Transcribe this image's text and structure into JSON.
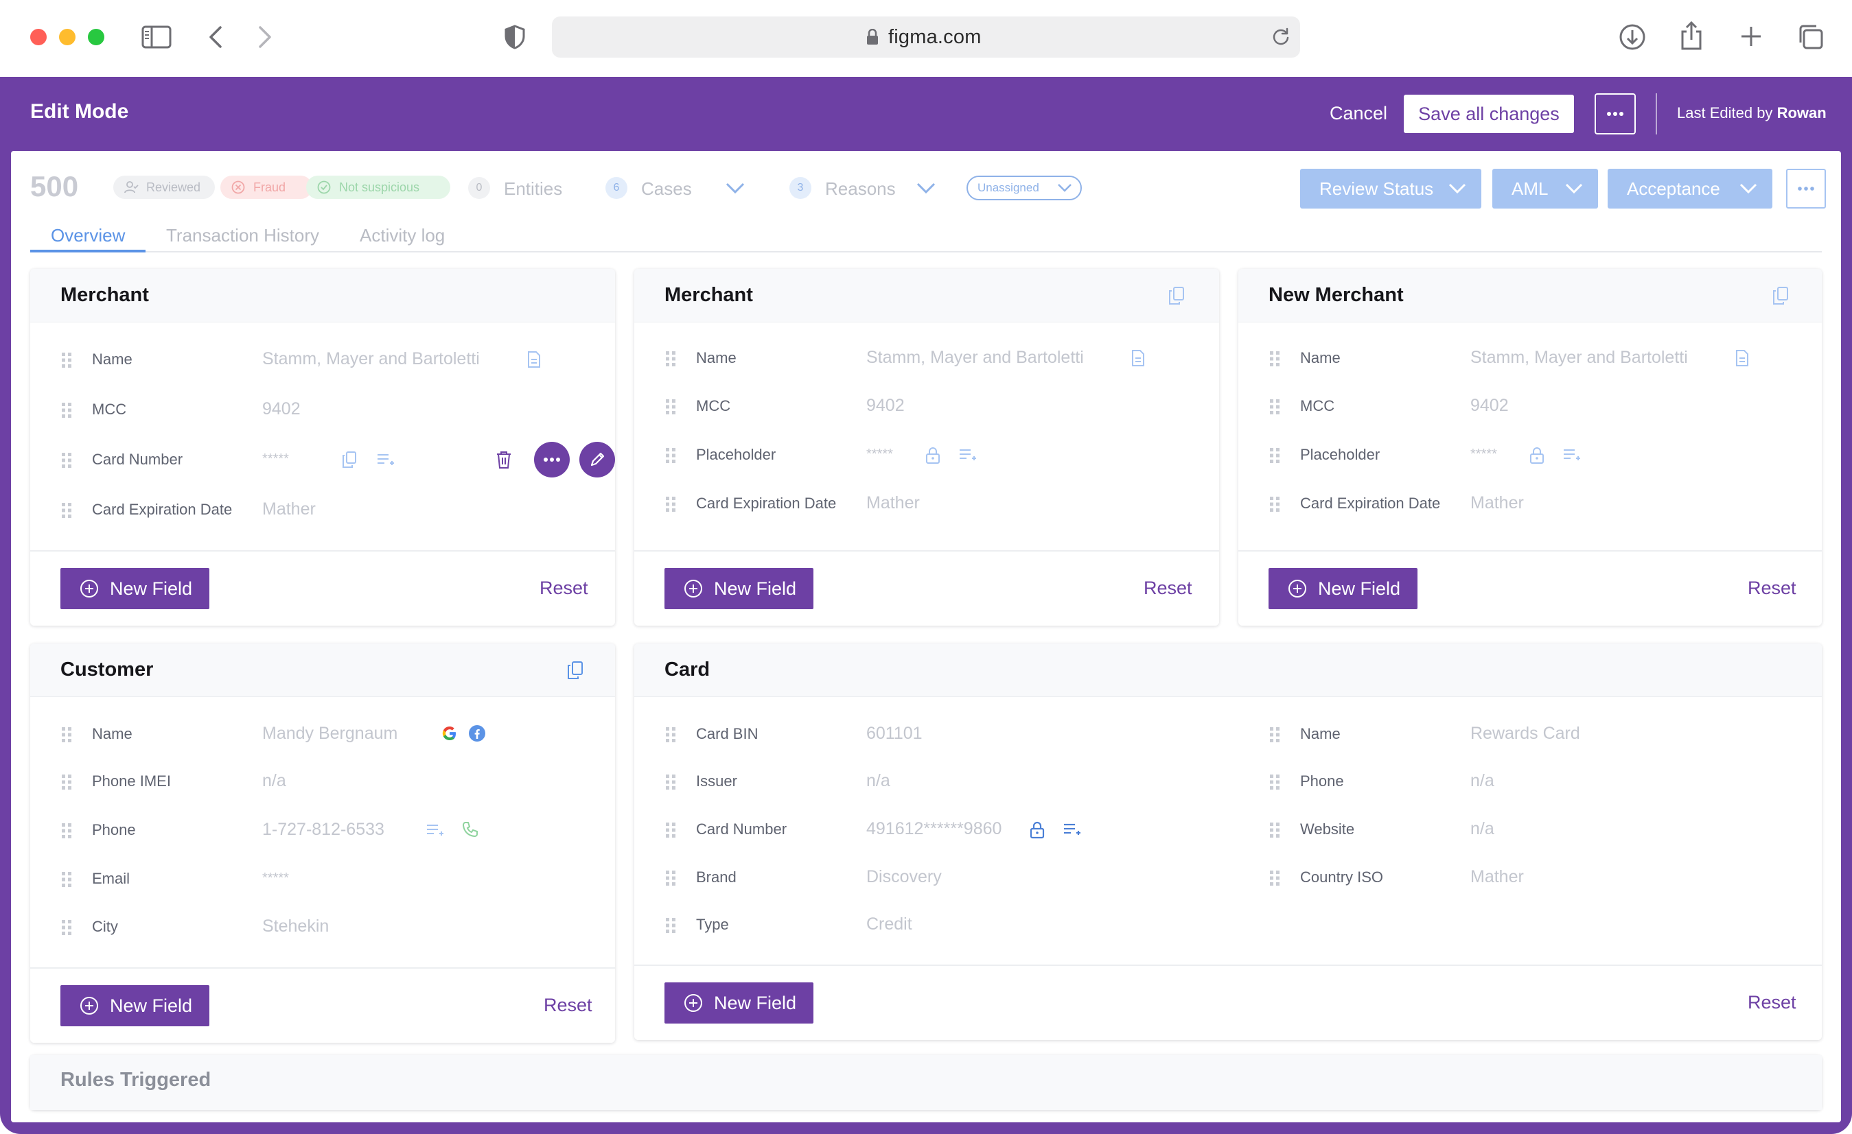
{
  "browser": {
    "url": "figma.com"
  },
  "header": {
    "title": "Edit Mode",
    "cancel": "Cancel",
    "save": "Save all changes",
    "edited_prefix": "Last Edited by",
    "edited_by": "Rowan"
  },
  "status": {
    "case_id": "500",
    "pills": {
      "reviewed": "Reviewed",
      "fraud": "Fraud",
      "not_suspicious": "Not suspicious"
    },
    "entities": {
      "count": "0",
      "label": "Entities"
    },
    "cases": {
      "count": "6",
      "label": "Cases"
    },
    "reasons": {
      "count": "3",
      "label": "Reasons"
    },
    "assignee": "Unassigned",
    "buttons": {
      "review": "Review Status",
      "aml": "AML",
      "acceptance": "Acceptance"
    }
  },
  "tabs": [
    "Overview",
    "Transaction History",
    "Activity log"
  ],
  "common": {
    "new_field": "New Field",
    "reset": "Reset"
  },
  "merchant1": {
    "title": "Merchant",
    "fields": [
      {
        "label": "Name",
        "value": "Stamm, Mayer and Bartoletti"
      },
      {
        "label": "MCC",
        "value": "9402"
      },
      {
        "label": "Card Number",
        "value": "*****"
      },
      {
        "label": "Card Expiration Date",
        "value": "Mather"
      }
    ]
  },
  "merchant2": {
    "title": "Merchant",
    "fields": [
      {
        "label": "Name",
        "value": "Stamm, Mayer and Bartoletti"
      },
      {
        "label": "MCC",
        "value": "9402"
      },
      {
        "label": "Placeholder",
        "value": "*****"
      },
      {
        "label": "Card Expiration Date",
        "value": "Mather"
      }
    ]
  },
  "merchant3": {
    "title": "New Merchant",
    "fields": [
      {
        "label": "Name",
        "value": "Stamm, Mayer and Bartoletti"
      },
      {
        "label": "MCC",
        "value": "9402"
      },
      {
        "label": "Placeholder",
        "value": "*****"
      },
      {
        "label": "Card Expiration Date",
        "value": "Mather"
      }
    ]
  },
  "customer": {
    "title": "Customer",
    "fields": [
      {
        "label": "Name",
        "value": "Mandy Bergnaum"
      },
      {
        "label": "Phone IMEI",
        "value": "n/a"
      },
      {
        "label": "Phone",
        "value": "1-727-812-6533"
      },
      {
        "label": "Email",
        "value": "*****"
      },
      {
        "label": "City",
        "value": "Stehekin"
      }
    ]
  },
  "card": {
    "title": "Card",
    "left": [
      {
        "label": "Card BIN",
        "value": "601101"
      },
      {
        "label": "Issuer",
        "value": "n/a"
      },
      {
        "label": "Card Number",
        "value": "491612******9860"
      },
      {
        "label": "Brand",
        "value": "Discovery"
      },
      {
        "label": "Type",
        "value": "Credit"
      }
    ],
    "right": [
      {
        "label": "Name",
        "value": "Rewards Card"
      },
      {
        "label": "Phone",
        "value": "n/a"
      },
      {
        "label": "Website",
        "value": "n/a"
      },
      {
        "label": "Country ISO",
        "value": "Mather"
      }
    ]
  },
  "rules": {
    "title": "Rules Triggered"
  },
  "colors": {
    "accent": "#6d40a4",
    "blue": "#5b93e6",
    "button_blue": "#a6c4f2"
  },
  "icons": [
    "sidebar-icon",
    "back-icon",
    "forward-icon",
    "shield-icon",
    "lock-icon",
    "reload-icon",
    "download-icon",
    "share-icon",
    "plus-icon",
    "tabs-icon",
    "grip-icon",
    "document-icon",
    "copy-icon",
    "list-add-icon",
    "trash-icon",
    "more-icon",
    "pencil-icon",
    "google-icon",
    "facebook-icon",
    "phone-icon",
    "padlock-icon"
  ]
}
